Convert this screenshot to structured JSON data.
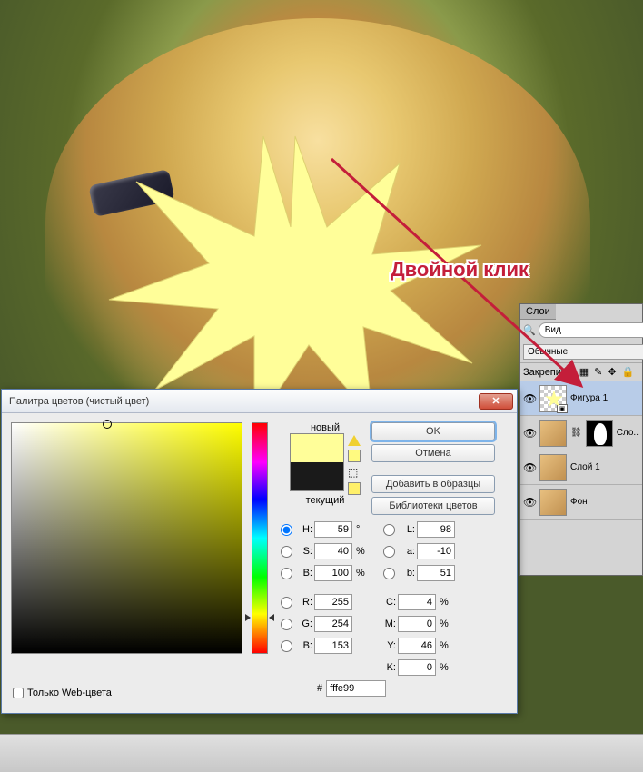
{
  "annotation": "Двойной клик",
  "dialog": {
    "title": "Палитра цветов (чистый цвет)",
    "new_label": "новый",
    "current_label": "текущий",
    "buttons": {
      "ok": "OK",
      "cancel": "Отмена",
      "add": "Добавить в образцы",
      "libs": "Библиотеки цветов"
    },
    "hsb": {
      "h": "59",
      "s": "40",
      "b": "100"
    },
    "rgb": {
      "r": "255",
      "g": "254",
      "b": "153"
    },
    "lab": {
      "l": "98",
      "a": "-10",
      "b": "51"
    },
    "cmyk": {
      "c": "4",
      "m": "0",
      "y": "46",
      "k": "0"
    },
    "hex": "fffe99",
    "web_only": "Только Web-цвета"
  },
  "layers": {
    "tab": "Слои",
    "search_ph": "Вид",
    "mode": "Обычные",
    "lock_label": "Закрепить:",
    "items": [
      {
        "name": "Фигура 1"
      },
      {
        "name": "Сло..."
      },
      {
        "name": "Слой 1"
      },
      {
        "name": "Фон"
      }
    ]
  }
}
